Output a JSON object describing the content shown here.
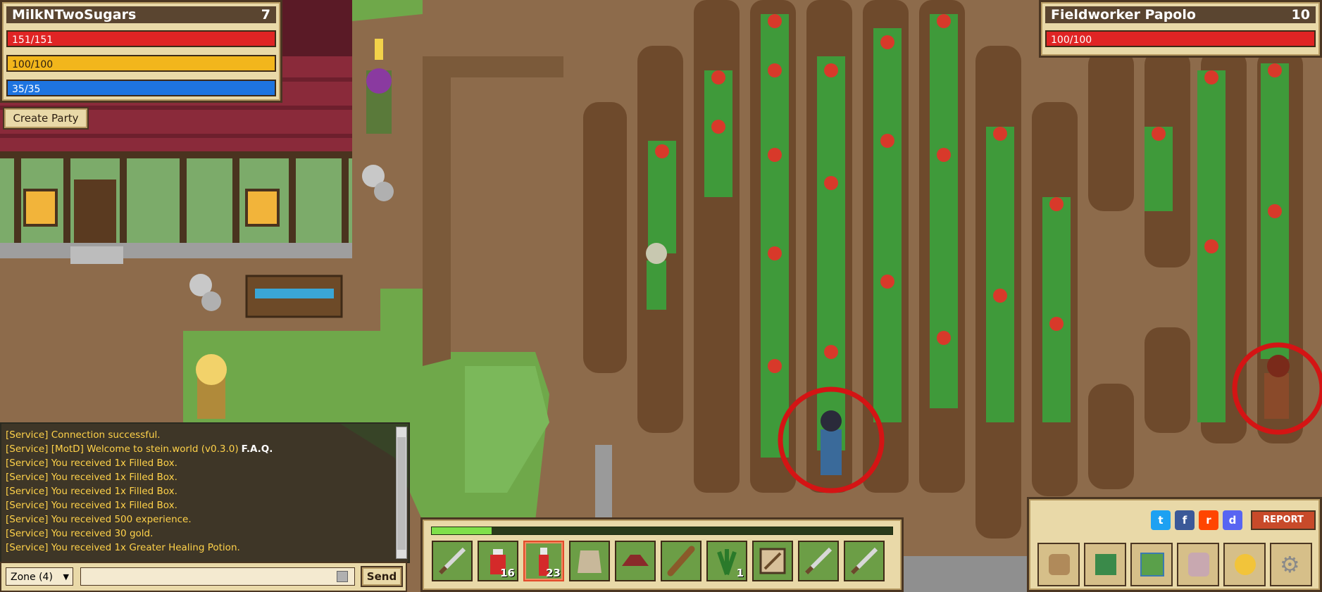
{
  "player": {
    "name": "MilkNTwoSugars",
    "level": "7",
    "hp": "151/151",
    "stamina": "100/100",
    "mana": "35/35",
    "hp_fraction": 1.0,
    "stamina_fraction": 1.0,
    "mana_fraction": 1.0
  },
  "target": {
    "name": "Fieldworker Papolo",
    "level": "10",
    "hp": "100/100",
    "hp_fraction": 1.0
  },
  "party": {
    "create_label": "Create Party"
  },
  "chat": {
    "lines": [
      {
        "text": "[Service] Connection successful.",
        "link": ""
      },
      {
        "text": "[Service] [MotD] Welcome to stein.world (v0.3.0)",
        "link": "F.A.Q."
      },
      {
        "text": "[Service] You received 1x Filled Box.",
        "link": ""
      },
      {
        "text": "[Service] You received 1x Filled Box.",
        "link": ""
      },
      {
        "text": "[Service] You received 1x Filled Box.",
        "link": ""
      },
      {
        "text": "[Service] You received 1x Filled Box.",
        "link": ""
      },
      {
        "text": "[Service] You received 500 experience.",
        "link": ""
      },
      {
        "text": "[Service] You received 30 gold.",
        "link": ""
      },
      {
        "text": "[Service] You received 1x Greater Healing Potion.",
        "link": ""
      }
    ],
    "channel": "Zone (4)",
    "input_value": "",
    "send_label": "Send"
  },
  "hotbar": {
    "xp_fraction": 0.13,
    "slots": [
      {
        "icon": "sword-icon",
        "count": ""
      },
      {
        "icon": "health-potion-icon",
        "count": "16"
      },
      {
        "icon": "greater-health-potion-icon",
        "count": "23"
      },
      {
        "icon": "tunic-armor-icon",
        "count": ""
      },
      {
        "icon": "hat-icon",
        "count": ""
      },
      {
        "icon": "wooden-club-icon",
        "count": ""
      },
      {
        "icon": "herb-icon",
        "count": "1"
      },
      {
        "icon": "pickaxe-icon",
        "count": ""
      },
      {
        "icon": "sword-icon",
        "count": ""
      },
      {
        "icon": "sword-icon",
        "count": ""
      }
    ]
  },
  "menu": {
    "report_label": "REPORT",
    "social": [
      "twitter-icon",
      "facebook-icon",
      "reddit-icon",
      "discord-icon"
    ],
    "buttons": [
      "inventory-bag-icon",
      "quest-book-icon",
      "map-icon",
      "character-armor-icon",
      "gold-coins-icon",
      "settings-gear-icon"
    ]
  },
  "colors": {
    "hp": "#e02424",
    "stamina": "#f2b61c",
    "mana": "#1e74e0",
    "target_ring": "#d41414"
  }
}
